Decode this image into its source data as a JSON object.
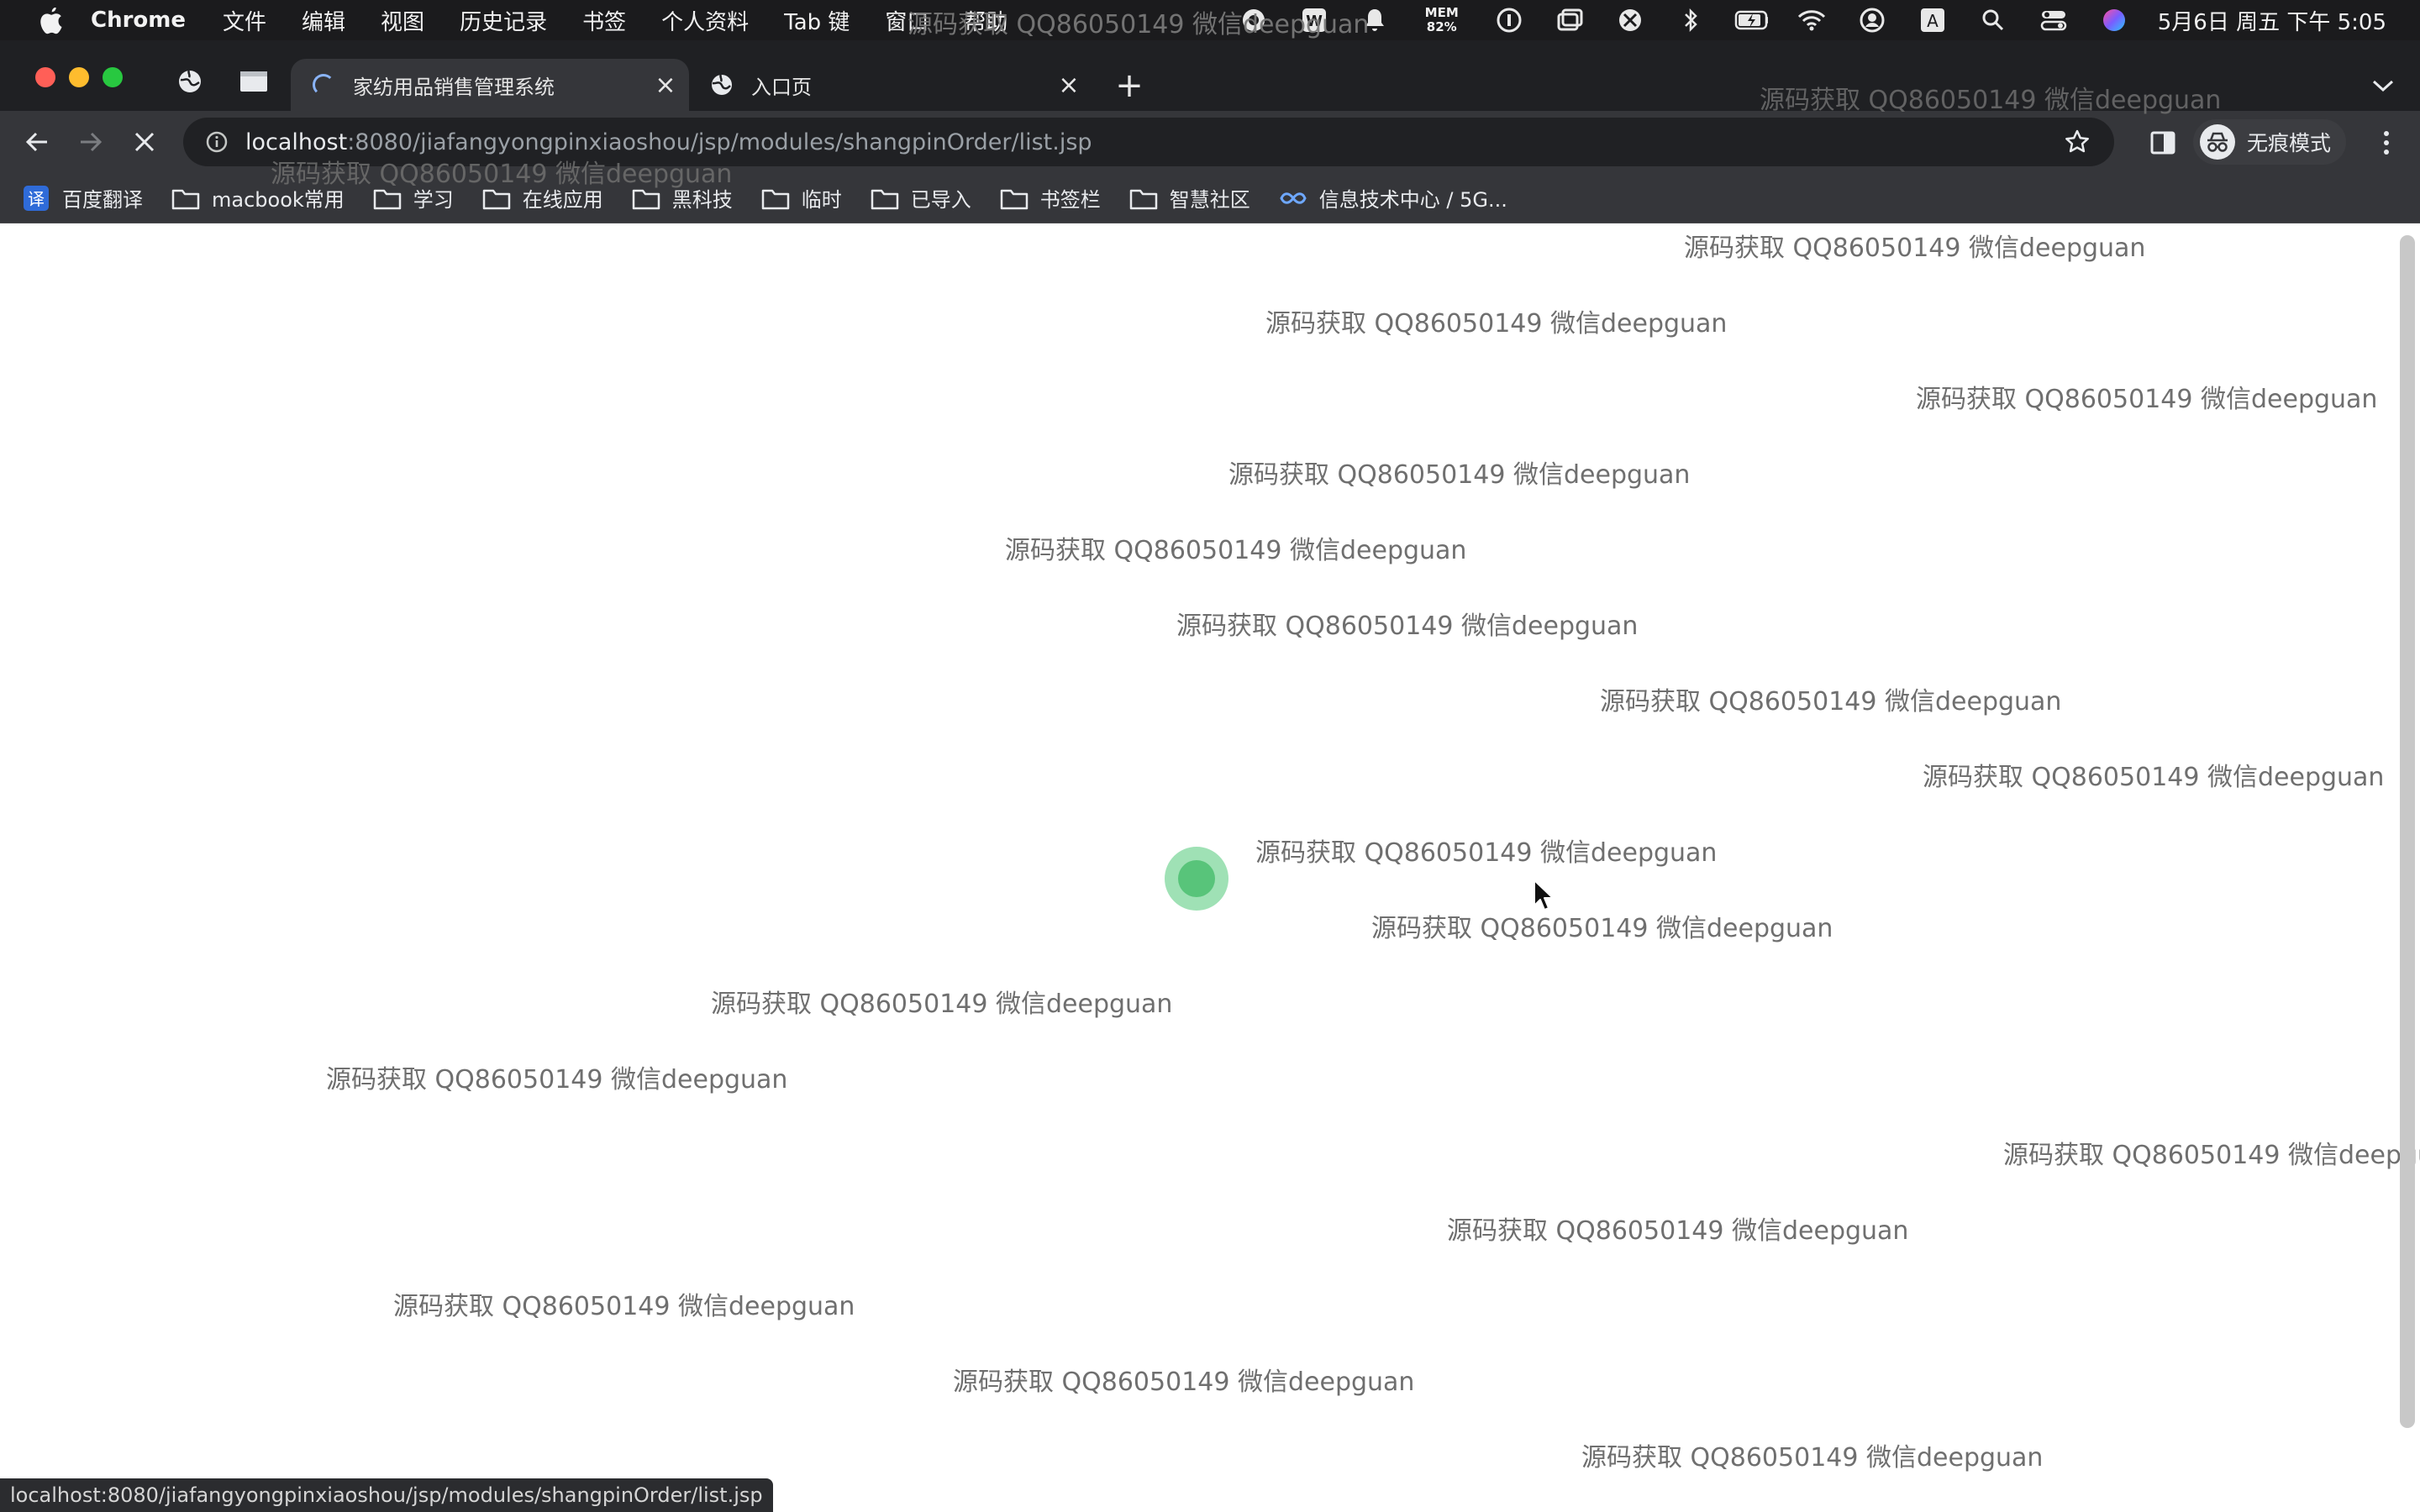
{
  "menubar": {
    "app_name": "Chrome",
    "items": [
      "文件",
      "编辑",
      "视图",
      "历史记录",
      "书签",
      "个人资料",
      "Tab 键",
      "窗口",
      "帮助"
    ],
    "mem_label": "MEM",
    "mem_value": "82%",
    "clock": "5月6日 周五 下午 5:05"
  },
  "tabs": [
    {
      "title": "家纺用品销售管理系统",
      "loading": true,
      "active": true
    },
    {
      "title": "入口页",
      "loading": false,
      "active": false
    }
  ],
  "toolbar": {
    "url_host": "localhost",
    "url_rest": ":8080/jiafangyongpinxiaoshou/jsp/modules/shangpinOrder/list.jsp",
    "incognito_label": "无痕模式"
  },
  "bookmarks": [
    {
      "label": "百度翻译",
      "icon": "fanyi-icon"
    },
    {
      "label": "macbook常用",
      "icon": "folder-icon"
    },
    {
      "label": "学习",
      "icon": "folder-icon"
    },
    {
      "label": "在线应用",
      "icon": "folder-icon"
    },
    {
      "label": "黑科技",
      "icon": "folder-icon"
    },
    {
      "label": "临时",
      "icon": "folder-icon"
    },
    {
      "label": "已导入",
      "icon": "folder-icon"
    },
    {
      "label": "书签栏",
      "icon": "folder-icon"
    },
    {
      "label": "智慧社区",
      "icon": "folder-icon"
    },
    {
      "label": "信息技术中心 / 5G...",
      "icon": "link-icon"
    }
  ],
  "watermark": {
    "text": "源码获取 QQ86050149 微信deepguan"
  },
  "status_bar": {
    "url": "localhost:8080/jiafangyongpinxiaoshou/jsp/modules/shangpinOrder/list.jsp"
  },
  "colors": {
    "menubar_bg": "#1b1b1d",
    "tabstrip_bg": "#1f2023",
    "toolbar_bg": "#35363a",
    "omnibox_bg": "#202124",
    "loader_green": "#58c47a",
    "watermark_text": "#6f6f6f"
  }
}
